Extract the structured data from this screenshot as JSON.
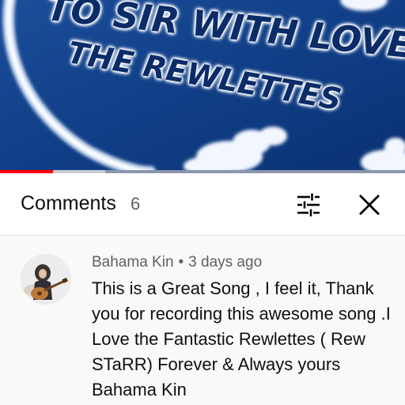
{
  "video": {
    "title_line1": "TO SIR WITH LOVE",
    "title_line2": "THE REWLETTES",
    "progress": {
      "played": 0.13,
      "buffered": 0.26
    },
    "colors": {
      "background": "#0d3a7e",
      "progress_played": "#ff0000"
    }
  },
  "comments_panel": {
    "title": "Comments",
    "count": "6",
    "filter_icon": "sort-filter-icon",
    "close_icon": "close-icon"
  },
  "comment": {
    "author": "Bahama Kin",
    "separator": "•",
    "time": "3 days ago",
    "text": "This is a Great Song , I feel it, Thank you for recording this awesome song .I Love the Fantastic Rewlettes ( Rew STaRR) Forever & Always yours Bahama Kin"
  }
}
